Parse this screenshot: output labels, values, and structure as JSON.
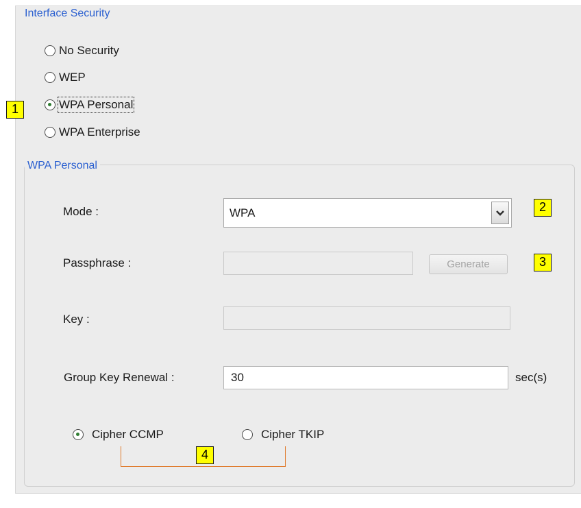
{
  "interface_security": {
    "legend": "Interface Security",
    "options": [
      {
        "label": "No Security",
        "checked": false
      },
      {
        "label": "WEP",
        "checked": false
      },
      {
        "label": "WPA Personal",
        "checked": true
      },
      {
        "label": "WPA Enterprise",
        "checked": false
      }
    ]
  },
  "wpa_personal": {
    "legend": "WPA Personal",
    "mode": {
      "label": "Mode :",
      "value": "WPA"
    },
    "passphrase": {
      "label": "Passphrase :",
      "value": "",
      "generate_label": "Generate"
    },
    "key": {
      "label": "Key :",
      "value": ""
    },
    "group_key_renewal": {
      "label": "Group Key Renewal :",
      "value": "30",
      "unit": "sec(s)"
    },
    "cipher": [
      {
        "label": "Cipher CCMP",
        "checked": true
      },
      {
        "label": "Cipher TKIP",
        "checked": false
      }
    ]
  },
  "callouts": {
    "c1": "1",
    "c2": "2",
    "c3": "3",
    "c4": "4"
  },
  "colors": {
    "legend_text": "#2a5fd0",
    "panel_background": "#ececec",
    "callout_fill": "#ffff00",
    "bracket_stroke": "#e07a2b"
  },
  "icons": {
    "mode_dropdown": "chevron-down-icon"
  }
}
